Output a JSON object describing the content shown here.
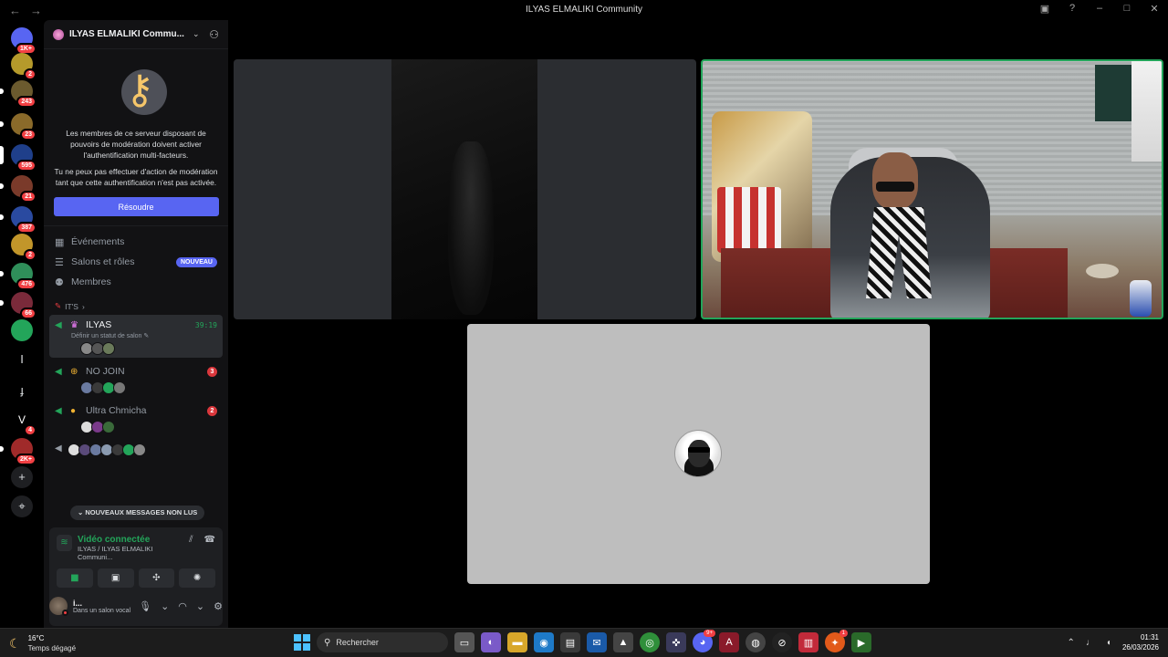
{
  "window": {
    "title": "ILYAS ELMALIKI Community",
    "back": "←",
    "forward": "→"
  },
  "rail": {
    "servers": [
      {
        "badge": "1K+",
        "color": "#5865f2"
      },
      {
        "badge": "2",
        "color": "#b59a2b"
      },
      {
        "badge": "243",
        "color": "#6b5a2e"
      },
      {
        "badge": "23",
        "color": "#8a6a2a"
      },
      {
        "badge": "595",
        "color": "#1f3f8a"
      },
      {
        "badge": "21",
        "color": "#7a3a2a"
      },
      {
        "badge": "387",
        "color": "#2a4aa0"
      },
      {
        "badge": "2",
        "color": "#c2962a"
      },
      {
        "badge": "476",
        "color": "#2f8f5a"
      },
      {
        "badge": "66",
        "color": "#7a2a3a"
      },
      {
        "badge": "",
        "color": "#23a55a"
      }
    ],
    "letter_i": "I",
    "letter_v": "V",
    "v_badge": "4",
    "last_badge": "2K+",
    "add": "+",
    "discover": "⌖"
  },
  "guild": {
    "name": "ILYAS ELMALIKI Commu...",
    "mfa_text_1": "Les membres de ce serveur disposant de pouvoirs de modération doivent activer l'authentification multi-facteurs.",
    "mfa_text_2": "Tu ne peux pas effectuer d'action de modération tant que cette authentification n'est pas activée.",
    "resolve_label": "Résoudre"
  },
  "menu": {
    "events": "Événements",
    "channels_roles": "Salons et rôles",
    "new_badge": "NOUVEAU",
    "members": "Membres"
  },
  "category": {
    "name": "IT'S",
    "chevron": "›"
  },
  "channels": [
    {
      "name": "ILYAS",
      "timer": "39:19",
      "status": "Définir un statut de salon ✎"
    },
    {
      "name": "NO JOIN",
      "count": "3"
    },
    {
      "name": "Ultra Chmicha",
      "count": "2"
    }
  ],
  "unread": "⌄ NOUVEAUX MESSAGES NON LUS",
  "voice": {
    "status": "Vidéo connectée",
    "location": "ILYAS / ILYAS ELMALIKI Communi..."
  },
  "user": {
    "name": "i...",
    "status": "Dans un salon vocal"
  },
  "taskbar": {
    "temperature": "16°C",
    "weather": "Temps dégagé",
    "search_placeholder": "Rechercher",
    "time": "01:31",
    "date": "26/03/2026",
    "discord_badge": "9+",
    "app_badge": "1"
  }
}
